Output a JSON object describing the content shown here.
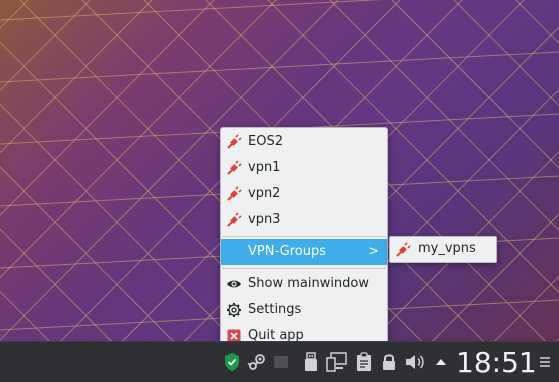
{
  "menu": {
    "items": [
      {
        "label": "EOS2",
        "icon": "vpn-plug-icon"
      },
      {
        "label": "vpn1",
        "icon": "vpn-plug-icon"
      },
      {
        "label": "vpn2",
        "icon": "vpn-plug-icon"
      },
      {
        "label": "vpn3",
        "icon": "vpn-plug-icon"
      }
    ],
    "vpn_groups": {
      "label": "VPN-Groups",
      "arrow": ">"
    },
    "show_mainwindow": {
      "label": "Show mainwindow",
      "icon": "eye-icon"
    },
    "settings": {
      "label": "Settings",
      "icon": "gear-icon"
    },
    "quit": {
      "label": "Quit app",
      "icon": "close-icon"
    }
  },
  "submenu": {
    "items": [
      {
        "label": "my_vpns",
        "icon": "vpn-plug-icon"
      }
    ]
  },
  "panel": {
    "clock": "18:51",
    "tray_icons": [
      "shield-check-icon",
      "steam-icon",
      "usb-drive-icon",
      "network-icon",
      "clipboard-icon",
      "lock-icon",
      "volume-icon",
      "arrow-up-icon",
      "hamburger-icon"
    ]
  },
  "colors": {
    "highlight": "#3daee9",
    "menu_bg": "#eff0f1",
    "panel_bg": "#2e3033",
    "plug_red": "#d9453b",
    "shield_green": "#1d9b4a"
  }
}
